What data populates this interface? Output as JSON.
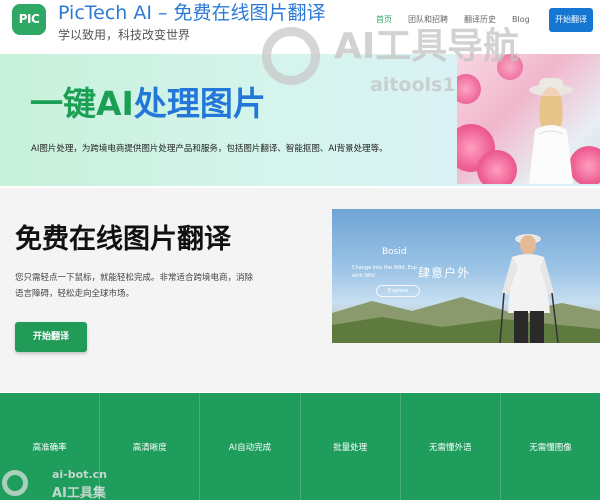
{
  "header": {
    "logo_text": "PIC",
    "title": "PicTech AI – 免费在线图片翻译",
    "slogan": "学以致用，科技改变世界",
    "nav": [
      {
        "label": "首页",
        "active": true
      },
      {
        "label": "团队和招聘",
        "active": false
      },
      {
        "label": "翻译历史",
        "active": false
      },
      {
        "label": "Blog",
        "active": false
      }
    ],
    "cta_label": "开始翻译"
  },
  "watermark": {
    "big_text": "AI工具导航",
    "url": "aitools1"
  },
  "hero": {
    "title_part1": "一键AI",
    "title_part2": "处理图片",
    "description": "AI图片处理，为跨境电商提供图片处理产品和服务，包括图片翻译、智能抠图、AI背景处理等。"
  },
  "translate_section": {
    "title": "免费在线图片翻译",
    "description": "您只需轻点一下鼠标，就能轻松完成。非常适合跨境电商，消除语言障碍，轻松走向全球市场。",
    "button_label": "开始翻译",
    "ad": {
      "brand": "Bosid",
      "tagline_1": "Change into the Wild, Exp",
      "tagline_2": "with Wild",
      "cn_text": "肆意户外",
      "explore_label": "Explore"
    }
  },
  "features": [
    "高准确率",
    "高清晰度",
    "AI自动完成",
    "批量处理",
    "无需懂外语",
    "无需懂图像"
  ],
  "bottom_watermark": {
    "url": "ai-bot.cn",
    "cn": "AI工具集"
  },
  "colors": {
    "brand_green": "#1f9d5c",
    "brand_blue": "#1677d2",
    "title_blue": "#2b7bd6"
  }
}
